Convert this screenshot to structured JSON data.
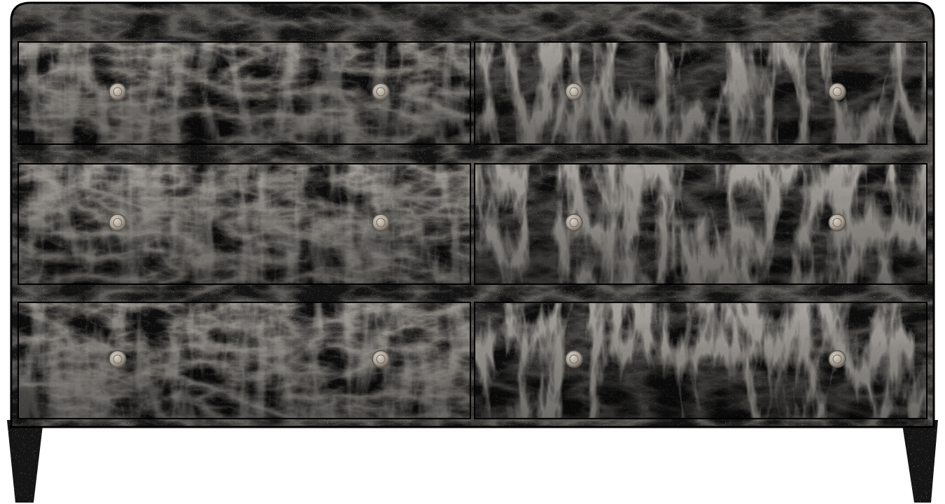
{
  "scene": {
    "subject": "dresser",
    "colors": {
      "background": "#ffffff",
      "base": "#141414",
      "swirl_dark": "#0a0a0a",
      "swirl_mid": "#3d3a36",
      "swirl_light": "#8a857c",
      "swirl_highlight": "#c9c4ba",
      "speckle": "#e6e6e6",
      "knob": "#a89f94",
      "knob_edge": "#5a544d"
    },
    "drawers": [
      {
        "row": 1,
        "column": 1,
        "knobs": 2
      },
      {
        "row": 1,
        "column": 2,
        "knobs": 2
      },
      {
        "row": 2,
        "column": 1,
        "knobs": 2
      },
      {
        "row": 2,
        "column": 2,
        "knobs": 2
      },
      {
        "row": 3,
        "column": 1,
        "knobs": 2
      },
      {
        "row": 3,
        "column": 2,
        "knobs": 2
      }
    ]
  }
}
